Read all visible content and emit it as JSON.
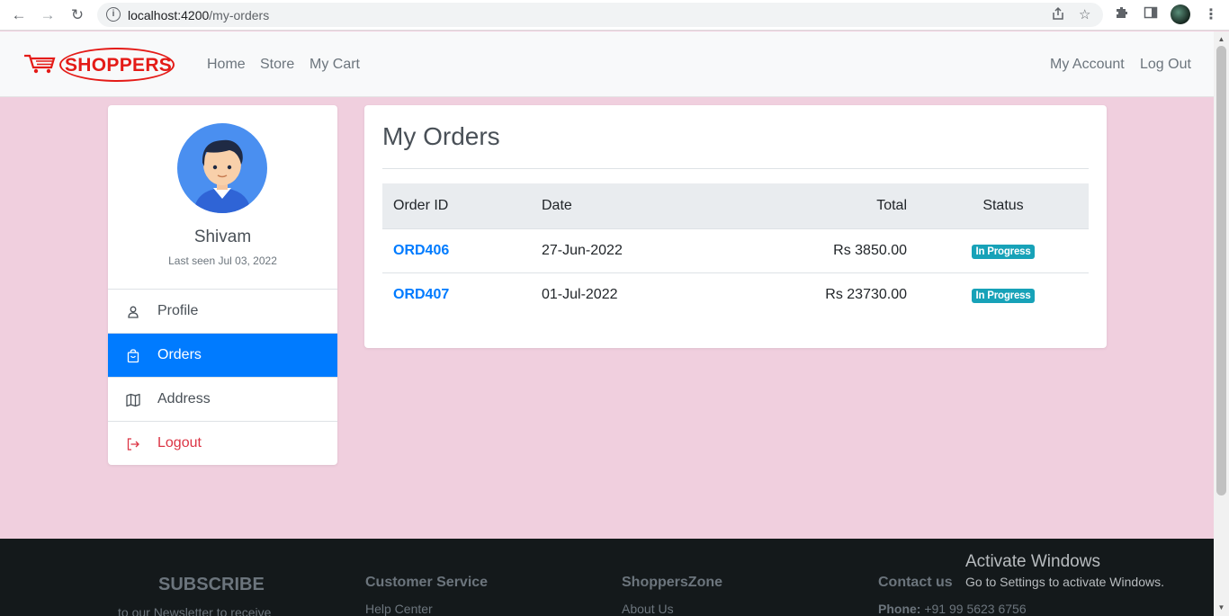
{
  "browser": {
    "url_host": "localhost:4200",
    "url_path": "/my-orders"
  },
  "navbar": {
    "brand": "SHOPPERS",
    "links": [
      "Home",
      "Store",
      "My Cart"
    ],
    "right_links": [
      "My Account",
      "Log Out"
    ]
  },
  "sidebar": {
    "user_name": "Shivam",
    "last_seen": "Last seen Jul 03, 2022",
    "menu": [
      {
        "label": "Profile",
        "icon": "person-icon"
      },
      {
        "label": "Orders",
        "icon": "bag-icon",
        "active": true
      },
      {
        "label": "Address",
        "icon": "map-icon"
      },
      {
        "label": "Logout",
        "icon": "logout-icon"
      }
    ]
  },
  "orders": {
    "title": "My Orders",
    "columns": [
      "Order ID",
      "Date",
      "Total",
      "Status"
    ],
    "rows": [
      {
        "id": "ORD406",
        "date": "27-Jun-2022",
        "total": "Rs 3850.00",
        "status": "In Progress"
      },
      {
        "id": "ORD407",
        "date": "01-Jul-2022",
        "total": "Rs 23730.00",
        "status": "In Progress"
      }
    ]
  },
  "footer": {
    "subscribe_title": "SUBSCRIBE",
    "subscribe_text": "to our Newsletter to receive",
    "customer_service": {
      "title": "Customer Service",
      "first_link": "Help Center"
    },
    "shoppers_zone": {
      "title": "ShoppersZone",
      "first_link": "About Us"
    },
    "contact": {
      "title": "Contact us",
      "phone_label": "Phone:",
      "phone_value": "+91 99 5623 6756"
    }
  },
  "watermark": {
    "line1": "Activate Windows",
    "line2": "Go to Settings to activate Windows."
  },
  "colors": {
    "page_bg": "#f0cfde",
    "primary": "#007bff",
    "badge": "#17a2b8",
    "danger": "#dc3545",
    "brand_red": "#e41b17",
    "footer_bg": "#14191b"
  }
}
